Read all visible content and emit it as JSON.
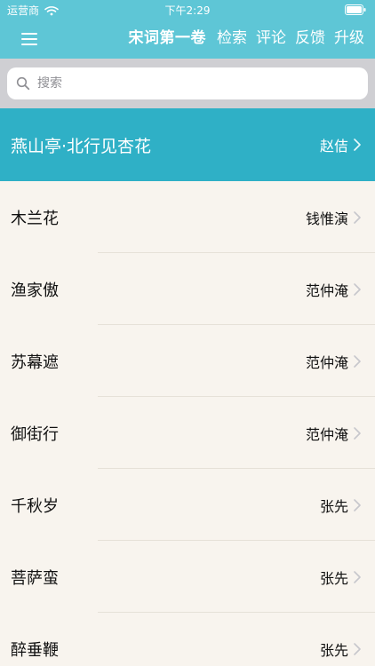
{
  "status": {
    "carrier": "运营商",
    "time": "下午2:29"
  },
  "nav": {
    "title": "宋词第一卷",
    "links": [
      "检索",
      "评论",
      "反馈",
      "升级"
    ]
  },
  "search": {
    "placeholder": "搜索"
  },
  "selected": {
    "title": "燕山亭·北行见杏花",
    "author": "赵佶"
  },
  "rows": [
    {
      "title": "木兰花",
      "author": "钱惟演"
    },
    {
      "title": "渔家傲",
      "author": "范仲淹"
    },
    {
      "title": "苏幕遮",
      "author": "范仲淹"
    },
    {
      "title": "御街行",
      "author": "范仲淹"
    },
    {
      "title": "千秋岁",
      "author": "张先"
    },
    {
      "title": "菩萨蛮",
      "author": "张先"
    },
    {
      "title": "醉垂鞭",
      "author": "张先"
    }
  ],
  "colors": {
    "nav_bg": "#5ec6d6",
    "selected_bg": "#2fb0c6",
    "list_bg": "#f8f4ee",
    "search_bar_bg": "#cfcfd3"
  },
  "icons": {
    "menu": "menu-icon",
    "wifi": "wifi-icon",
    "battery": "battery-icon",
    "search": "search-icon",
    "chevron": "chevron-right-icon"
  }
}
